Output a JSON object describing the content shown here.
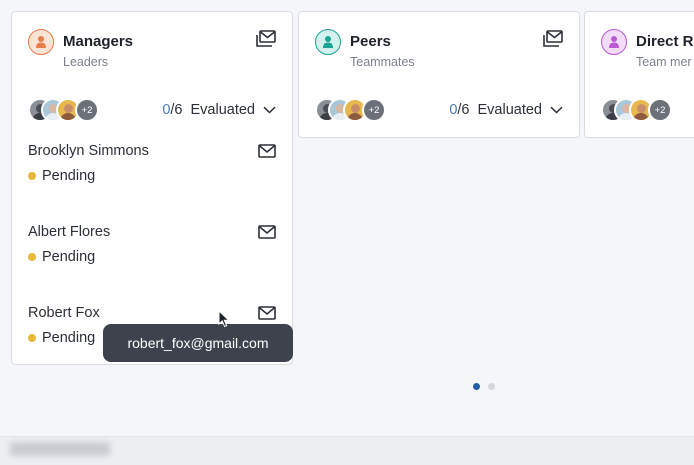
{
  "colors": {
    "accent": "#1f5fa8",
    "pending": "#e8b93a",
    "tooltip_bg": "#3d424c",
    "managers_icon": "#e77d4a",
    "peers_icon": "#1aa394",
    "direct_icon": "#b85ad6"
  },
  "cards": [
    {
      "title": "Managers",
      "subtitle": "Leaders",
      "icon": "person-icon",
      "more_count": "+2",
      "evaluated_done": "0",
      "evaluated_total": "/6",
      "evaluated_label": "Evaluated",
      "reviewers": [
        {
          "name": "Brooklyn Simmons",
          "status": "Pending"
        },
        {
          "name": "Albert Flores",
          "status": "Pending"
        },
        {
          "name": "Robert Fox",
          "status": "Pending"
        }
      ]
    },
    {
      "title": "Peers",
      "subtitle": "Teammates",
      "icon": "person-icon",
      "more_count": "+2",
      "evaluated_done": "0",
      "evaluated_total": "/6",
      "evaluated_label": "Evaluated"
    },
    {
      "title": "Direct Re",
      "subtitle": "Team mer",
      "icon": "person-icon",
      "more_count": "+2"
    }
  ],
  "tooltip": {
    "text": "robert_fox@gmail.com"
  },
  "pagination": {
    "current_page": 1,
    "total_pages": 2
  }
}
